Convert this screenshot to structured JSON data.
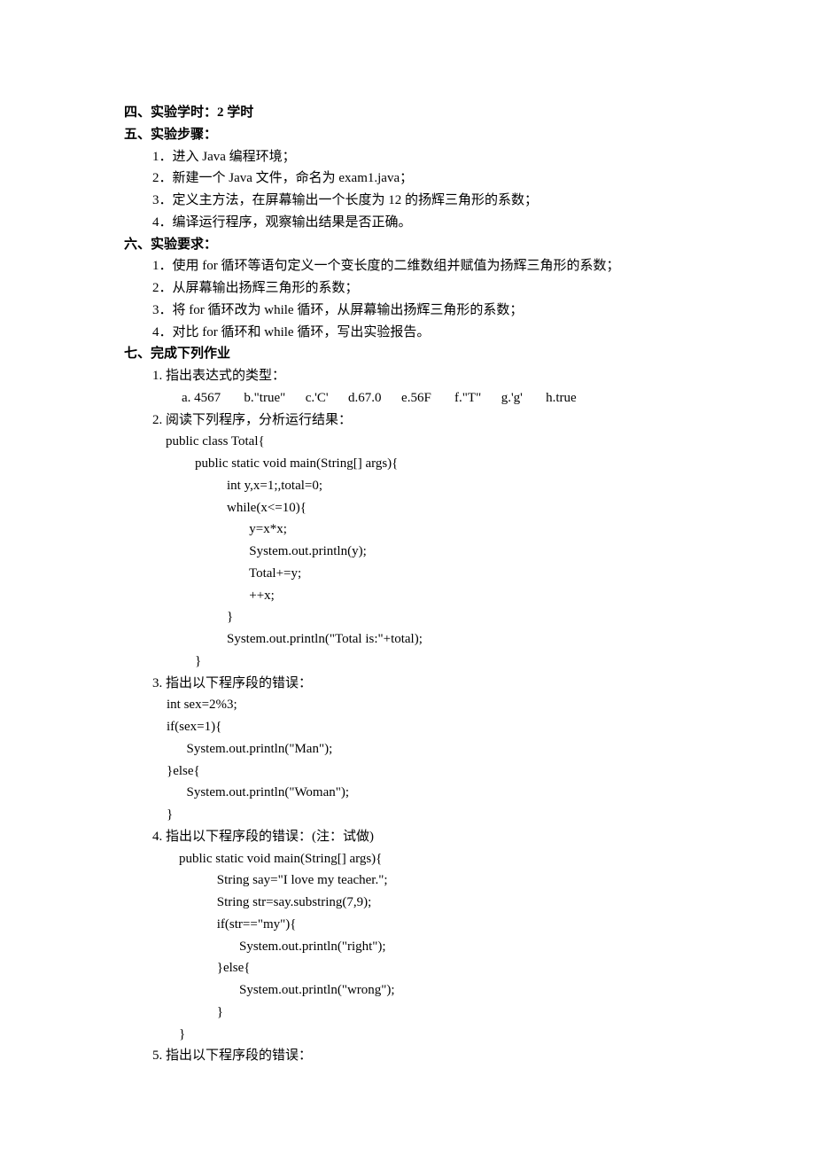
{
  "sections": {
    "s4": {
      "num": "四、",
      "title": "实验学时：2 学时"
    },
    "s5": {
      "num": "五、",
      "title": "实验步骤：",
      "items": [
        "1．进入 Java 编程环境；",
        "2．新建一个 Java 文件，命名为 exam1.java；",
        "3．定义主方法，在屏幕输出一个长度为 12 的扬辉三角形的系数；",
        "4．编译运行程序，观察输出结果是否正确。"
      ]
    },
    "s6": {
      "num": "六、",
      "title": "实验要求：",
      "items": [
        "1．使用 for 循环等语句定义一个变长度的二维数组并赋值为扬辉三角形的系数；",
        "2．从屏幕输出扬辉三角形的系数；",
        "3．将 for 循环改为 while 循环，从屏幕输出扬辉三角形的系数；",
        "4．对比 for 循环和 while 循环，写出实验报告。"
      ]
    },
    "s7": {
      "num": "七、",
      "title": "完成下列作业",
      "q1": {
        "prompt": "1.    指出表达式的类型：",
        "row": "a. 4567       b.\"true\"      c.'C'      d.67.0      e.56F       f.\"T\"      g.'g'       h.true"
      },
      "q2": {
        "prompt": "2.    阅读下列程序，分析运行结果：",
        "code": [
          "public class Total{",
          "    public static void main(String[] args){",
          "        int y,x=1;,total=0;",
          "        while(x<=10){",
          "           y=x*x;",
          "           System.out.println(y);",
          "           Total+=y;",
          "           ++x;",
          "        }",
          "        System.out.println(\"Total is:\"+total);",
          "    }"
        ]
      },
      "q3": {
        "prompt": "3.    指出以下程序段的错误：",
        "code": [
          "int sex=2%3;",
          "if(sex=1){",
          "      System.out.println(\"Man\");",
          "}else{",
          "      System.out.println(\"Woman\");",
          "}"
        ]
      },
      "q4": {
        "prompt": "4.    指出以下程序段的错误：(注：试做)",
        "code": [
          "public static void main(String[] args){",
          "     String say=\"I love my teacher.\";",
          "     String str=say.substring(7,9);",
          "     if(str==\"my\"){",
          "        System.out.println(\"right\");",
          "     }else{",
          "        System.out.println(\"wrong\");",
          "     }",
          "}"
        ]
      },
      "q5": {
        "prompt": "5.    指出以下程序段的错误："
      }
    }
  }
}
